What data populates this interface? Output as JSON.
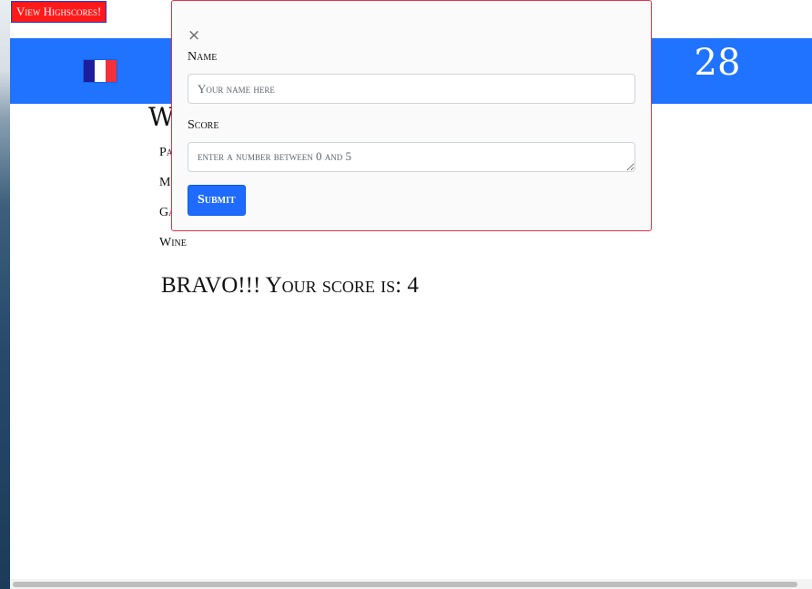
{
  "header": {
    "highscores_button": "View Highscores!",
    "counter": "28",
    "flag_icon": "france-flag-icon"
  },
  "background": {
    "heading": "W",
    "items": [
      "Pa",
      "M",
      "Ga",
      "Wine"
    ],
    "result": "BRAVO!!! Your score is: 4"
  },
  "modal": {
    "close_icon": "close-icon",
    "close_glyph": "×",
    "name_label": "Name",
    "name_placeholder": "Your name here",
    "score_label": "Score",
    "score_placeholder": "enter a number between 0 and 5",
    "submit_label": "Submit"
  },
  "colors": {
    "banner": "#1f73ff",
    "highscores_bg": "#ff1a1a",
    "modal_border": "#e2344d",
    "submit_bg": "#1f6bff"
  }
}
